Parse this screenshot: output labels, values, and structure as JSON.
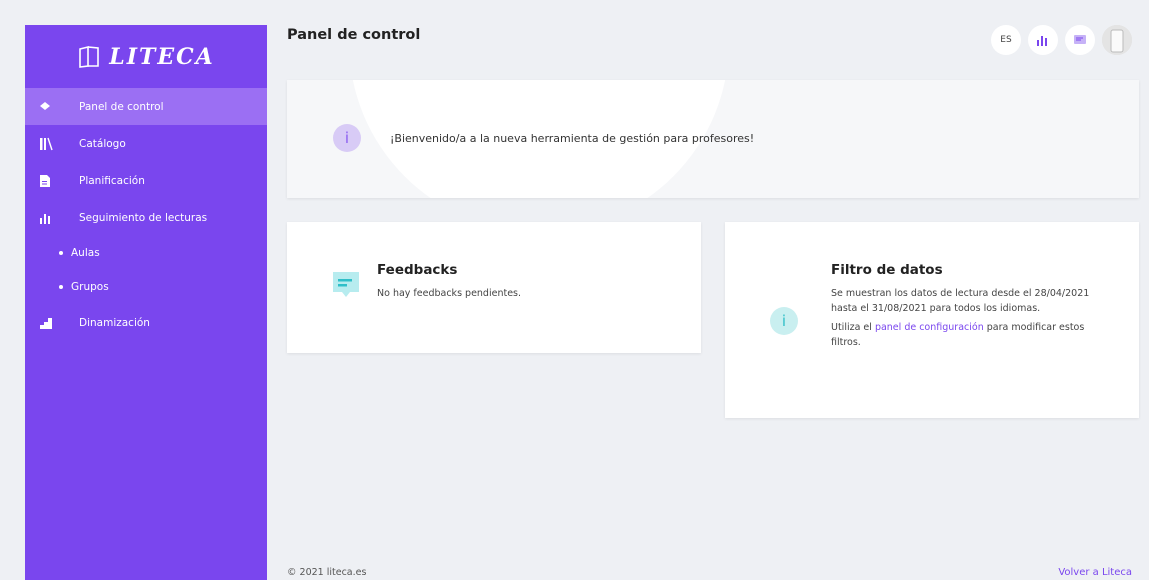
{
  "brand": {
    "name": "LITECA",
    "color": "#7a46ee"
  },
  "sidebar": {
    "items": [
      {
        "label": "Panel de control",
        "icon": "diamond-icon",
        "active": true
      },
      {
        "label": "Catálogo",
        "icon": "books-icon"
      },
      {
        "label": "Planificación",
        "icon": "document-icon"
      },
      {
        "label": "Seguimiento de lecturas",
        "icon": "bar-chart-icon"
      }
    ],
    "subitems": [
      {
        "label": "Aulas"
      },
      {
        "label": "Grupos"
      }
    ],
    "last_item": {
      "label": "Dinamización",
      "icon": "stairs-chart-icon"
    }
  },
  "header": {
    "title": "Panel de control",
    "lang": "ES"
  },
  "welcome": {
    "text": "¡Bienvenido/a a la nueva herramienta de gestión para profesores!"
  },
  "feedbacks": {
    "title": "Feedbacks",
    "text": "No hay feedbacks pendientes."
  },
  "filtro": {
    "title": "Filtro de datos",
    "text": "Se muestran los datos de lectura desde el 28/04/2021 hasta el 31/08/2021 para todos los idiomas.",
    "text2_pre": "Utiliza el ",
    "text2_link": "panel de configuración",
    "text2_post": " para modificar estos filtros."
  },
  "footer": {
    "copyright": "© 2021 liteca.es",
    "back_link": "Volver a Liteca"
  }
}
